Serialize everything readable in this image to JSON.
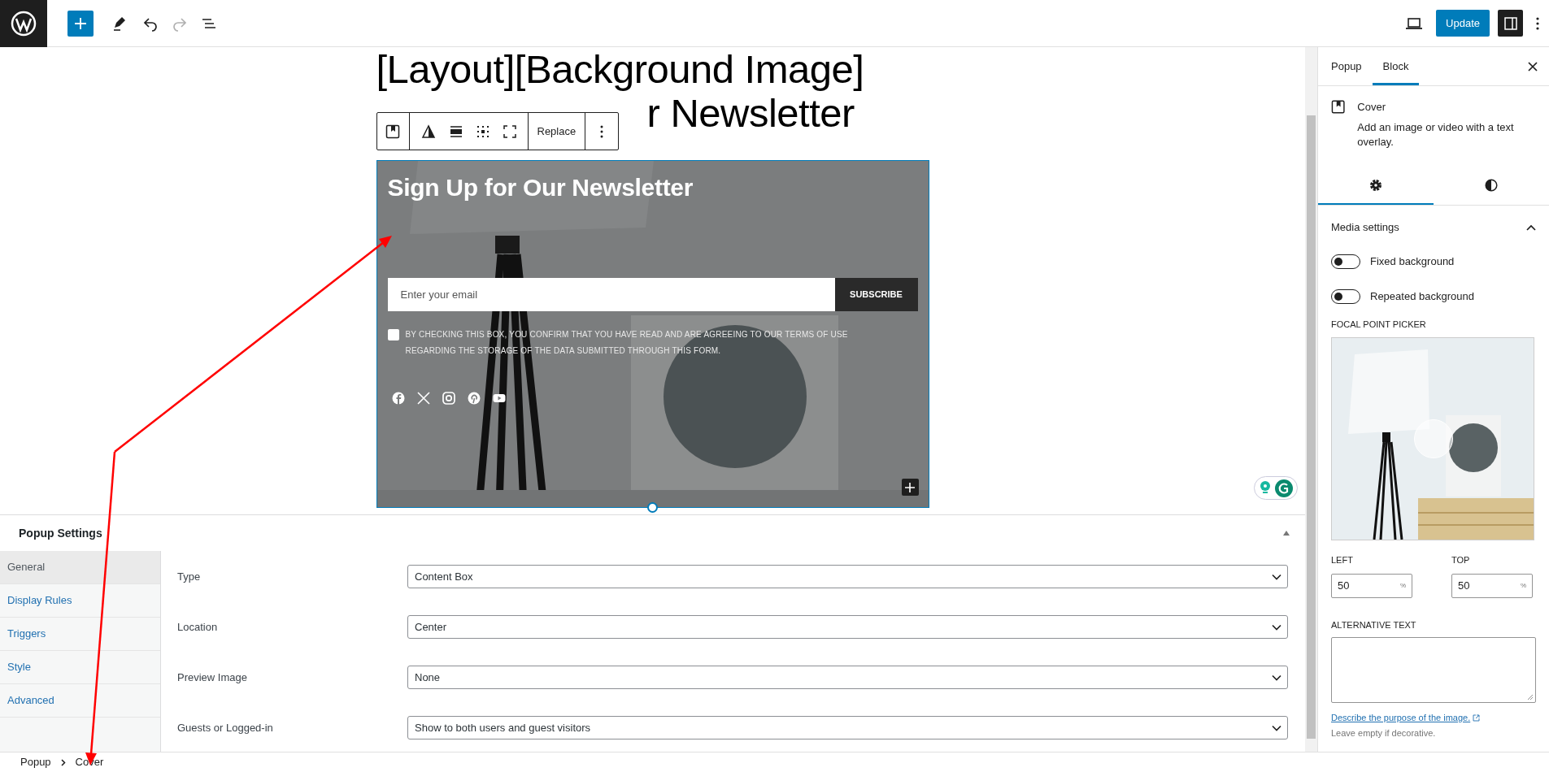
{
  "top_bar": {
    "update_label": "Update"
  },
  "page_title": {
    "lines": [
      "[Layout][Background Image]",
      "r Newsletter"
    ]
  },
  "block_toolbar": {
    "replace_label": "Replace"
  },
  "cover": {
    "heading": "Sign Up for Our Newsletter",
    "email_placeholder": "Enter your email",
    "subscribe_label": "SUBSCRIBE",
    "consent": {
      "checked": false,
      "text": "BY CHECKING THIS BOX, YOU CONFIRM THAT YOU HAVE READ AND ARE AGREEING TO OUR TERMS OF USE REGARDING THE STORAGE OF THE DATA SUBMITTED THROUGH THIS FORM."
    },
    "social": [
      {
        "kind": "facebook"
      },
      {
        "kind": "x"
      },
      {
        "kind": "instagram"
      },
      {
        "kind": "pinterest"
      },
      {
        "kind": "youtube"
      }
    ]
  },
  "popup_settings": {
    "title": "Popup Settings",
    "expanded": true,
    "tabs": [
      {
        "label": "General",
        "selected": true
      },
      {
        "label": "Display Rules",
        "selected": false
      },
      {
        "label": "Triggers",
        "selected": false
      },
      {
        "label": "Style",
        "selected": false
      },
      {
        "label": "Advanced",
        "selected": false
      }
    ],
    "fields": [
      {
        "label": "Type",
        "value": "Content Box"
      },
      {
        "label": "Location",
        "value": "Center"
      },
      {
        "label": "Preview Image",
        "value": "None"
      },
      {
        "label": "Guests or Logged-in",
        "value": "Show to both users and guest visitors"
      }
    ]
  },
  "breadcrumb": [
    "Popup",
    "Cover"
  ],
  "sidebar": {
    "tabs": [
      {
        "label": "Popup",
        "selected": false
      },
      {
        "label": "Block",
        "selected": true
      }
    ],
    "block": {
      "name": "Cover",
      "description": "Add an image or video with a text overlay."
    },
    "sub_tabs": [
      {
        "kind": "settings",
        "selected": true
      },
      {
        "kind": "styles",
        "selected": false
      }
    ],
    "media_settings": {
      "title": "Media settings",
      "expanded": true,
      "toggles": [
        {
          "label": "Fixed background",
          "on": false
        },
        {
          "label": "Repeated background",
          "on": false
        }
      ]
    },
    "focal_point": {
      "label": "FOCAL POINT PICKER",
      "left": {
        "label": "LEFT",
        "value": "50",
        "unit": "%"
      },
      "top": {
        "label": "TOP",
        "value": "50",
        "unit": "%"
      }
    },
    "alt_text": {
      "label": "ALTERNATIVE TEXT",
      "link": "Describe the purpose of the image.",
      "help": "Leave empty if decorative."
    }
  }
}
